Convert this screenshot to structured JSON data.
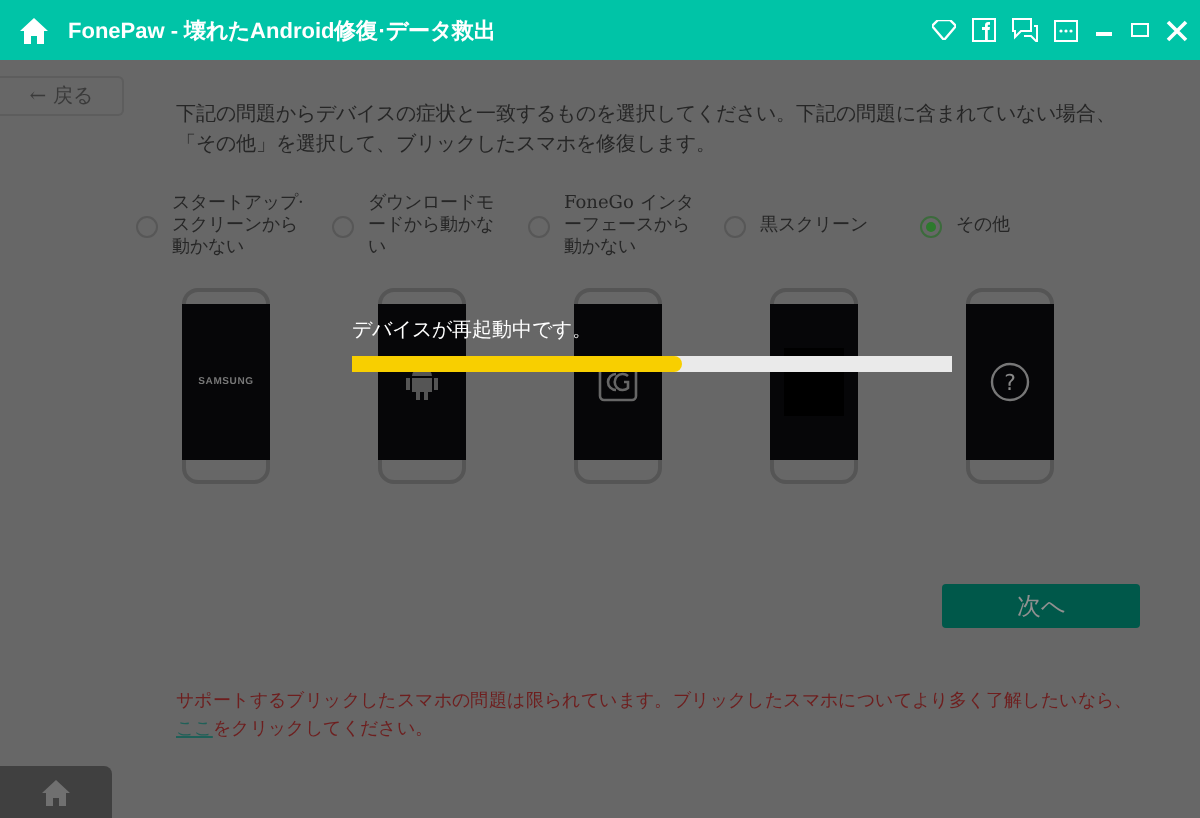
{
  "window": {
    "title": "FonePaw - 壊れたAndroid修復·データ救出"
  },
  "back_button": {
    "label": "← 戻る",
    "disabled": true
  },
  "description": "下記の問題からデバイスの症状と一致するものを選択してください。下記の問題に含まれていない場合、「その他」を選択して、ブリックしたスマホを修復します。",
  "options": [
    {
      "label": "スタートアップ·スクリーンから動かない",
      "selected": false,
      "kind": "samsung",
      "screen_text": "SAMSUNG"
    },
    {
      "label": "ダウンロードモードから動かない",
      "selected": false,
      "kind": "android"
    },
    {
      "label": "FoneGo インターフェースから動かない",
      "selected": false,
      "kind": "logo"
    },
    {
      "label": "黒スクリーン",
      "selected": false,
      "kind": "black"
    },
    {
      "label": "その他",
      "selected": true,
      "kind": "question",
      "screen_text": "?"
    }
  ],
  "progress": {
    "message": "デバイスが再起動中です。",
    "level": 0.55
  },
  "next_button": {
    "label": "次へ"
  },
  "footer": {
    "text_before": "サポートするブリックしたスマホの問題は限られています。ブリックしたスマホについてより多く了解したいなら、",
    "link": "ここ",
    "text_after": "をクリックしてください。"
  }
}
